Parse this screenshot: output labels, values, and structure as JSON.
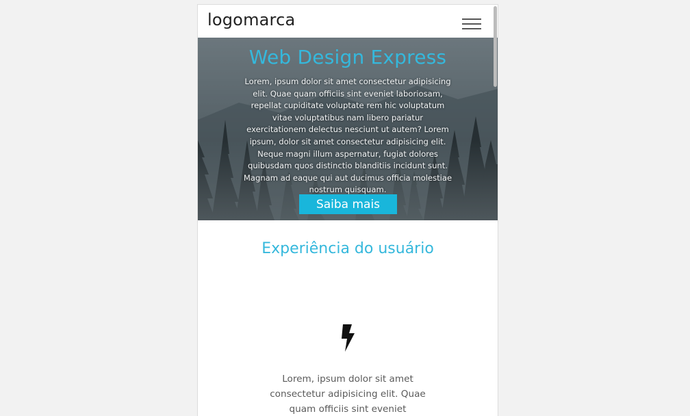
{
  "navbar": {
    "logo": "logomarca",
    "menu_icon": "hamburger-menu-icon"
  },
  "hero": {
    "title": "Web Design Express",
    "text": "Lorem, ipsum dolor sit amet consectetur adipisicing elit. Quae quam officiis sint eveniet laboriosam, repellat cupiditate voluptate rem hic voluptatum vitae voluptatibus nam libero pariatur exercitationem delectus nesciunt ut autem? Lorem ipsum, dolor sit amet consectetur adipisicing elit. Neque magni illum aspernatur, fugiat dolores quibusdam quos distinctio blanditiis incidunt sunt. Magnam ad eaque qui aut ducimus officia molestiae nostrum quisquam.",
    "button_label": "Saiba mais"
  },
  "features": {
    "title": "Experiência do usuário",
    "icon": "lightning-bolt-icon",
    "text": "Lorem, ipsum dolor sit amet consectetur adipisicing elit. Quae quam officiis sint eveniet"
  },
  "colors": {
    "accent": "#19b6db",
    "title": "#35b8dc",
    "background": "#f2f2f2"
  }
}
